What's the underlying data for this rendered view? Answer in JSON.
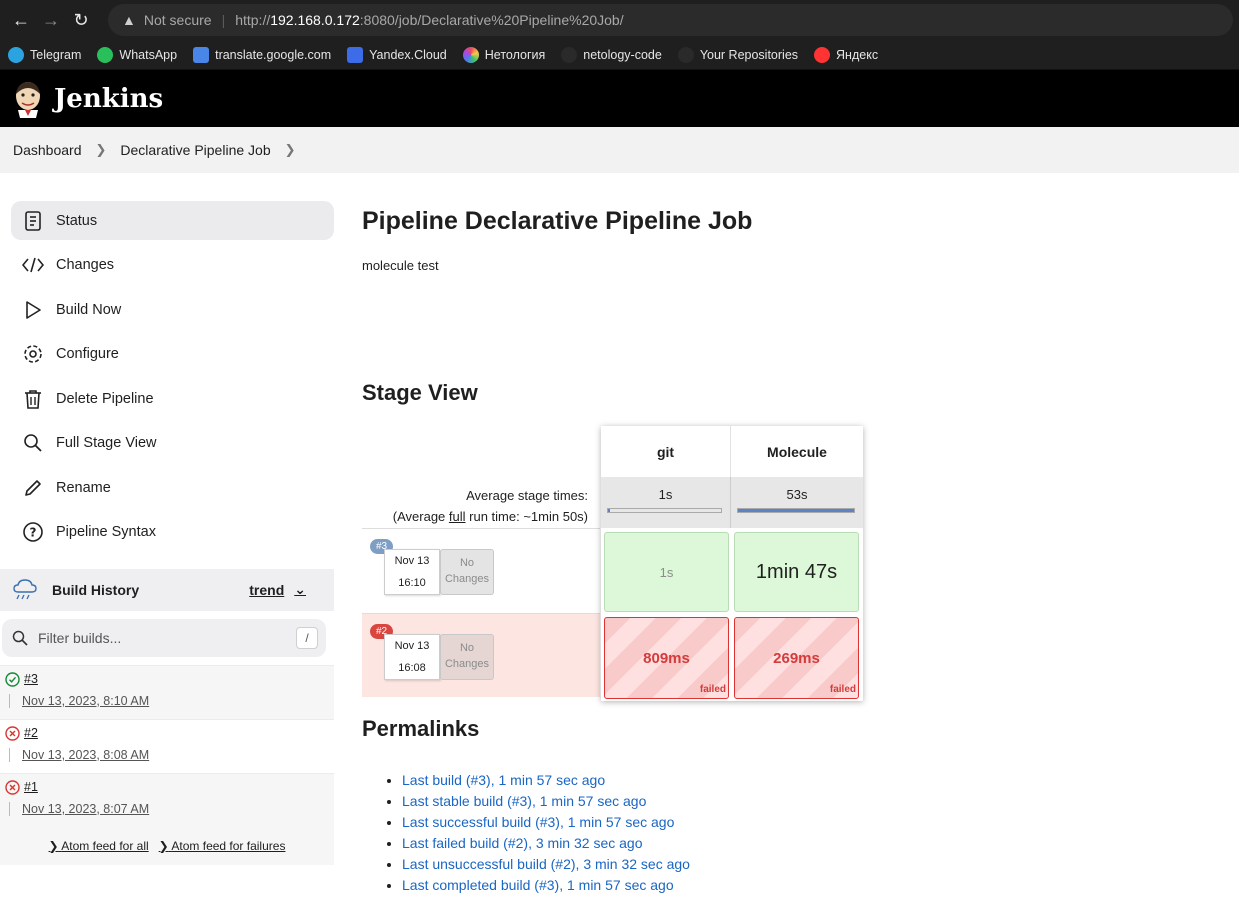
{
  "browser": {
    "not_secure": "Not secure",
    "url_prefix": "http://",
    "url_host": "192.168.0.172",
    "url_rest": ":8080/job/Declarative%20Pipeline%20Job/"
  },
  "bookmarks": [
    "Telegram",
    "WhatsApp",
    "translate.google.com",
    "Yandex.Cloud",
    "Нетология",
    "netology-code",
    "Your Repositories",
    "Яндекс"
  ],
  "header": {
    "title": "Jenkins"
  },
  "breadcrumbs": [
    "Dashboard",
    "Declarative Pipeline Job"
  ],
  "sidebar": {
    "tasks": [
      "Status",
      "Changes",
      "Build Now",
      "Configure",
      "Delete Pipeline",
      "Full Stage View",
      "Rename",
      "Pipeline Syntax"
    ]
  },
  "build_history": {
    "title": "Build History",
    "trend": "trend",
    "filter_placeholder": "Filter builds...",
    "shortcut": "/",
    "builds": [
      {
        "num": "#3",
        "date": "Nov 13, 2023, 8:10 AM",
        "status": "success"
      },
      {
        "num": "#2",
        "date": "Nov 13, 2023, 8:08 AM",
        "status": "failed"
      },
      {
        "num": "#1",
        "date": "Nov 13, 2023, 8:07 AM",
        "status": "failed"
      }
    ],
    "feed_all": "Atom feed for all",
    "feed_failures": "Atom feed for failures"
  },
  "main": {
    "title": "Pipeline Declarative Pipeline Job",
    "description": "molecule test",
    "stage_view_title": "Stage View",
    "avg_label": "Average stage times:",
    "avg_run_prefix": "(Average ",
    "avg_run_link": "full",
    "avg_run_suffix": " run time: ~1min 50s)",
    "stages": [
      {
        "name": "git",
        "avg": "1s",
        "avg_fraction": 0.02
      },
      {
        "name": "Molecule",
        "avg": "53s",
        "avg_fraction": 1.0
      }
    ],
    "runs": [
      {
        "badge": "#3",
        "month_day": "Nov 13",
        "time": "16:10",
        "no_changes": "No Changes",
        "cells": [
          "1s",
          "1min 47s"
        ],
        "failed": false
      },
      {
        "badge": "#2",
        "month_day": "Nov 13",
        "time": "16:08",
        "no_changes": "No Changes",
        "cells": [
          "809ms",
          "269ms"
        ],
        "failed": true,
        "failed_label": "failed"
      }
    ],
    "permalinks_title": "Permalinks",
    "permalinks": [
      "Last build (#3), 1 min 57 sec ago",
      "Last stable build (#3), 1 min 57 sec ago",
      "Last successful build (#3), 1 min 57 sec ago",
      "Last failed build (#2), 3 min 32 sec ago",
      "Last unsuccessful build (#2), 3 min 32 sec ago",
      "Last completed build (#3), 1 min 57 sec ago"
    ]
  },
  "colors": {
    "accent": "#1a66c4",
    "success": "#138a36",
    "failure": "#d33833",
    "header_bg": "#000000"
  }
}
